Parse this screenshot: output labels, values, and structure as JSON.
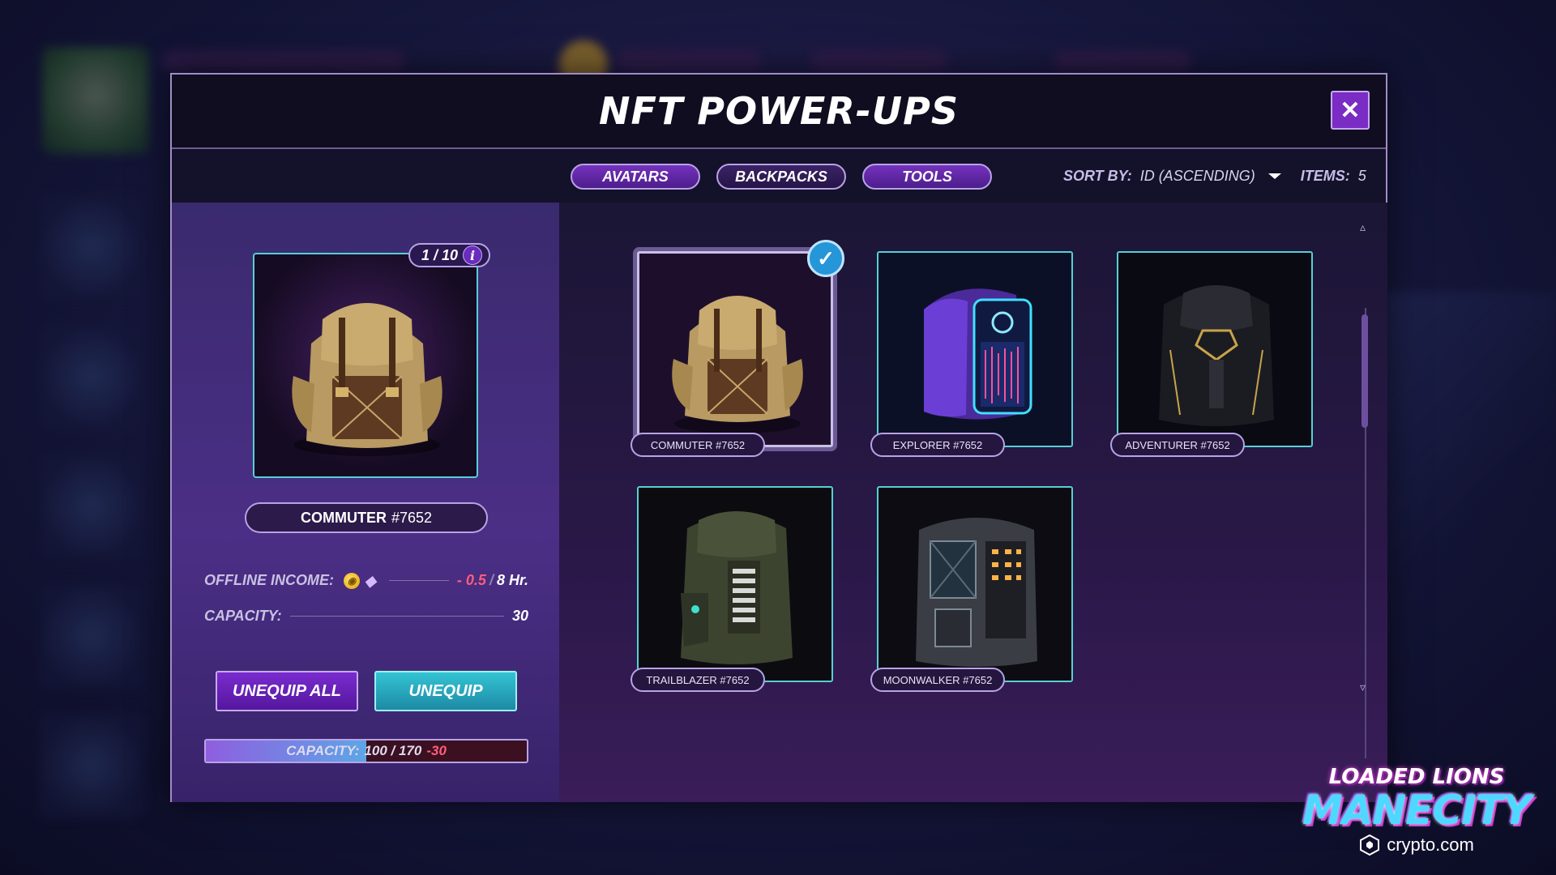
{
  "modal": {
    "title": "NFT POWER-UPS",
    "close_symbol": "✕"
  },
  "tabs": [
    {
      "label": "AVATARS"
    },
    {
      "label": "BACKPACKS"
    },
    {
      "label": "TOOLS"
    }
  ],
  "sort": {
    "label": "SORT BY:",
    "value": "ID (ASCENDING)",
    "items_label": "ITEMS:",
    "items_count": "5"
  },
  "selected": {
    "count": "1 / 10",
    "info_symbol": "i",
    "name": "COMMUTER",
    "id": "#7652",
    "offline_income_label": "OFFLINE INCOME:",
    "offline_income_value": "- 0.5",
    "offline_income_sep": "/",
    "offline_income_unit": "8 Hr.",
    "capacity_label": "CAPACITY:",
    "capacity_value": "30"
  },
  "buttons": {
    "unequip_all": "UNEQUIP ALL",
    "unequip": "UNEQUIP"
  },
  "capacity_bar": {
    "label": "CAPACITY:",
    "value": "100 / 170",
    "delta": "-30",
    "fill_fraction": 0.5
  },
  "items": [
    {
      "name": "COMMUTER #7652",
      "selected": true,
      "style": "commuter"
    },
    {
      "name": "EXPLORER #7652",
      "selected": false,
      "style": "explorer"
    },
    {
      "name": "ADVENTURER #7652",
      "selected": false,
      "style": "adventurer"
    },
    {
      "name": "TRAILBLAZER #7652",
      "selected": false,
      "style": "trailblazer"
    },
    {
      "name": "MOONWALKER #7652",
      "selected": false,
      "style": "moonwalker"
    }
  ],
  "logo": {
    "top": "LOADED LIONS",
    "main": "MANECITY",
    "partner": "crypto.com"
  },
  "colors": {
    "accent_purple": "#7b2cc4",
    "accent_teal": "#55d0d5",
    "negative": "#ff5d7a"
  }
}
